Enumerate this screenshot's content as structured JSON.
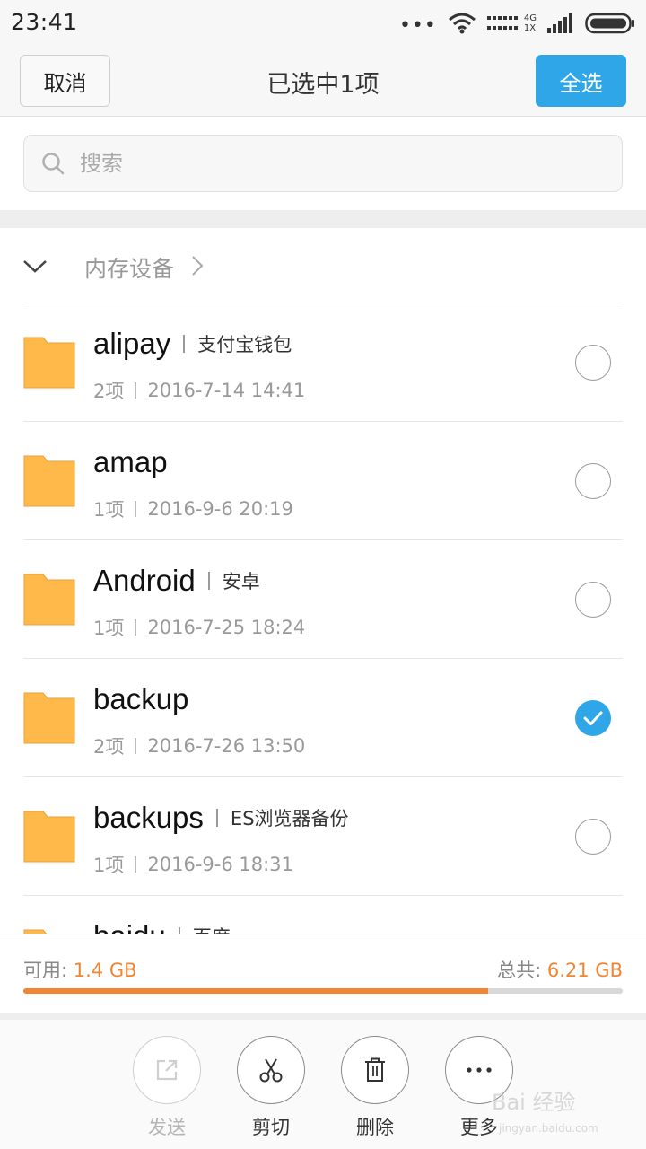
{
  "status": {
    "time": "23:41",
    "net_top": "4G",
    "net_bottom": "1X"
  },
  "titlebar": {
    "cancel_label": "取消",
    "title": "已选中1项",
    "select_all_label": "全选"
  },
  "search": {
    "placeholder": "搜索"
  },
  "breadcrumb": {
    "label": "内存设备"
  },
  "files": [
    {
      "name": "alipay",
      "alias": "支付宝钱包",
      "count": "2项",
      "date": "2016-7-14 14:41",
      "selected": false
    },
    {
      "name": "amap",
      "alias": "",
      "count": "1项",
      "date": "2016-9-6 20:19",
      "selected": false
    },
    {
      "name": "Android",
      "alias": "安卓",
      "count": "1项",
      "date": "2016-7-25 18:24",
      "selected": false
    },
    {
      "name": "backup",
      "alias": "",
      "count": "2项",
      "date": "2016-7-26 13:50",
      "selected": true
    },
    {
      "name": "backups",
      "alias": "ES浏览器备份",
      "count": "1项",
      "date": "2016-9-6 18:31",
      "selected": false
    },
    {
      "name": "baidu",
      "alias": "百度",
      "count": "",
      "date": "",
      "selected": false
    }
  ],
  "storage": {
    "available_label": "可用:",
    "available_value": "1.4 GB",
    "total_label": "总共:",
    "total_value": "6.21 GB",
    "used_fraction": 0.775
  },
  "actions": {
    "send_label": "发送",
    "cut_label": "剪切",
    "delete_label": "删除",
    "more_label": "更多"
  },
  "watermark": {
    "main": "Bai 经验",
    "sub": "jingyan.baidu.com"
  },
  "colors": {
    "accent": "#2ea6e8",
    "folder": "#ffb84a",
    "storage_bar": "#f08533"
  },
  "icons": {
    "folder": "folder-icon",
    "search": "search-icon",
    "send": "share-arrow-icon",
    "cut": "scissors-icon",
    "delete": "trash-icon",
    "more": "more-dots-icon"
  }
}
